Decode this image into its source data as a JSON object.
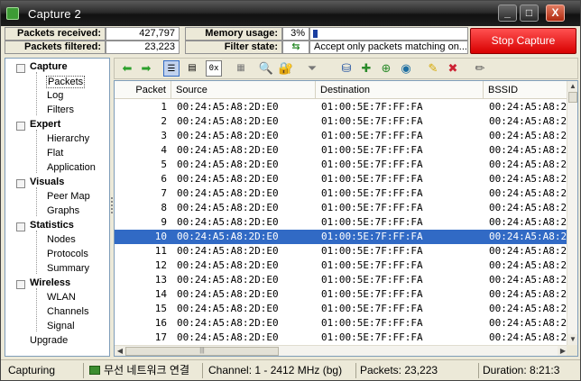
{
  "window": {
    "title": "Capture 2",
    "minimize": "_",
    "maximize": "□",
    "close": "X"
  },
  "stats": {
    "packets_received_label": "Packets received:",
    "packets_received": "427,797",
    "packets_filtered_label": "Packets filtered:",
    "packets_filtered": "23,223",
    "memory_label": "Memory usage:",
    "memory_value": "3%",
    "memory_fraction": 0.03,
    "filter_label": "Filter state:",
    "filter_value": "Accept only packets matching on...",
    "stop_button": "Stop Capture"
  },
  "nav": {
    "categories": [
      {
        "label": "Capture",
        "items": [
          "Packets",
          "Log",
          "Filters"
        ]
      },
      {
        "label": "Expert",
        "items": [
          "Hierarchy",
          "Flat",
          "Application"
        ]
      },
      {
        "label": "Visuals",
        "items": [
          "Peer Map",
          "Graphs"
        ]
      },
      {
        "label": "Statistics",
        "items": [
          "Nodes",
          "Protocols",
          "Summary"
        ]
      },
      {
        "label": "Wireless",
        "items": [
          "WLAN",
          "Channels",
          "Signal"
        ]
      },
      {
        "label": "Upgrade",
        "items": []
      }
    ],
    "selected": "Packets"
  },
  "toolbar": {
    "hex_label": "0x"
  },
  "grid": {
    "columns": [
      "Packet",
      "Source",
      "Destination",
      "BSSID"
    ],
    "rows": [
      {
        "packet": "1",
        "source": "00:24:A5:A8:2D:E0",
        "destination": "01:00:5E:7F:FF:FA",
        "bssid": "00:24:A5:A8:2"
      },
      {
        "packet": "2",
        "source": "00:24:A5:A8:2D:E0",
        "destination": "01:00:5E:7F:FF:FA",
        "bssid": "00:24:A5:A8:2"
      },
      {
        "packet": "3",
        "source": "00:24:A5:A8:2D:E0",
        "destination": "01:00:5E:7F:FF:FA",
        "bssid": "00:24:A5:A8:2"
      },
      {
        "packet": "4",
        "source": "00:24:A5:A8:2D:E0",
        "destination": "01:00:5E:7F:FF:FA",
        "bssid": "00:24:A5:A8:2"
      },
      {
        "packet": "5",
        "source": "00:24:A5:A8:2D:E0",
        "destination": "01:00:5E:7F:FF:FA",
        "bssid": "00:24:A5:A8:2"
      },
      {
        "packet": "6",
        "source": "00:24:A5:A8:2D:E0",
        "destination": "01:00:5E:7F:FF:FA",
        "bssid": "00:24:A5:A8:2"
      },
      {
        "packet": "7",
        "source": "00:24:A5:A8:2D:E0",
        "destination": "01:00:5E:7F:FF:FA",
        "bssid": "00:24:A5:A8:2"
      },
      {
        "packet": "8",
        "source": "00:24:A5:A8:2D:E0",
        "destination": "01:00:5E:7F:FF:FA",
        "bssid": "00:24:A5:A8:2"
      },
      {
        "packet": "9",
        "source": "00:24:A5:A8:2D:E0",
        "destination": "01:00:5E:7F:FF:FA",
        "bssid": "00:24:A5:A8:2"
      },
      {
        "packet": "10",
        "source": "00:24:A5:A8:2D:E0",
        "destination": "01:00:5E:7F:FF:FA",
        "bssid": "00:24:A5:A8:2"
      },
      {
        "packet": "11",
        "source": "00:24:A5:A8:2D:E0",
        "destination": "01:00:5E:7F:FF:FA",
        "bssid": "00:24:A5:A8:2"
      },
      {
        "packet": "12",
        "source": "00:24:A5:A8:2D:E0",
        "destination": "01:00:5E:7F:FF:FA",
        "bssid": "00:24:A5:A8:2"
      },
      {
        "packet": "13",
        "source": "00:24:A5:A8:2D:E0",
        "destination": "01:00:5E:7F:FF:FA",
        "bssid": "00:24:A5:A8:2"
      },
      {
        "packet": "14",
        "source": "00:24:A5:A8:2D:E0",
        "destination": "01:00:5E:7F:FF:FA",
        "bssid": "00:24:A5:A8:2"
      },
      {
        "packet": "15",
        "source": "00:24:A5:A8:2D:E0",
        "destination": "01:00:5E:7F:FF:FA",
        "bssid": "00:24:A5:A8:2"
      },
      {
        "packet": "16",
        "source": "00:24:A5:A8:2D:E0",
        "destination": "01:00:5E:7F:FF:FA",
        "bssid": "00:24:A5:A8:2"
      },
      {
        "packet": "17",
        "source": "00:24:A5:A8:2D:E0",
        "destination": "01:00:5E:7F:FF:FA",
        "bssid": "00:24:A5:A8:2"
      }
    ],
    "selected_packet": "10"
  },
  "statusbar": {
    "state": "Capturing",
    "adapter": "무선 네트워크 연결",
    "channel": "Channel: 1 - 2412 MHz (bg)",
    "packets": "Packets:  23,223",
    "duration": "Duration:  8:21:3"
  },
  "colors": {
    "selection": "#316ac5",
    "stop_button": "#e81010",
    "memory_bar": "#1b3fa0"
  }
}
